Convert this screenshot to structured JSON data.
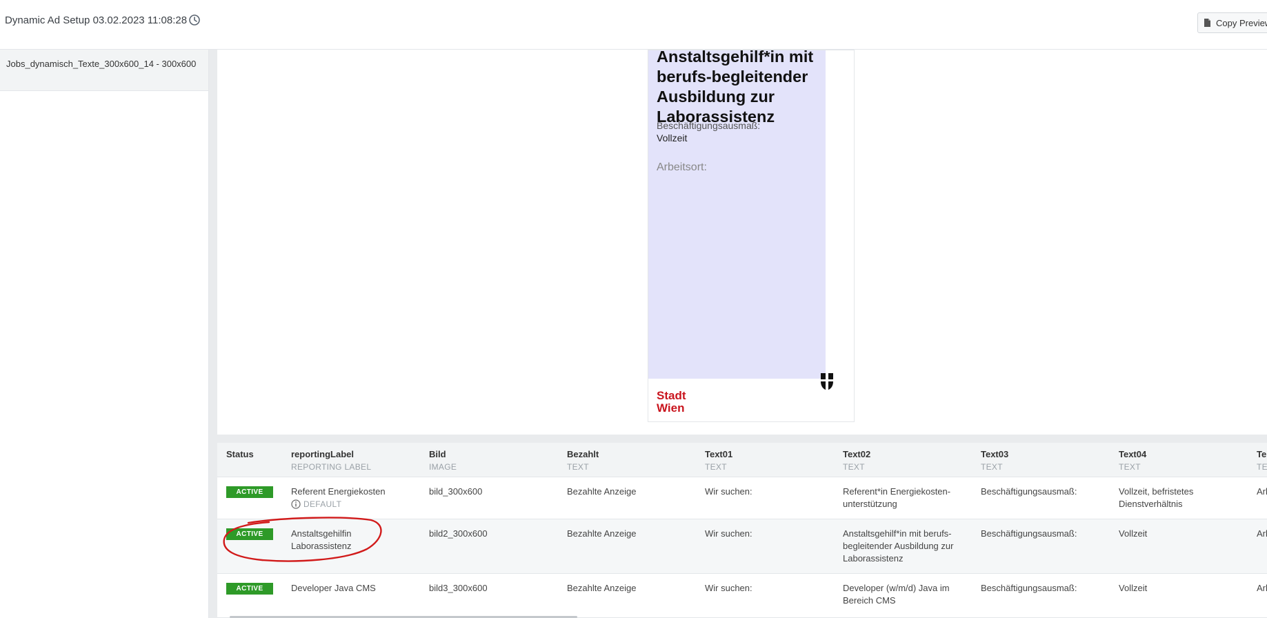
{
  "header": {
    "title": "Dynamic Ad Setup 03.02.2023 11:08:28",
    "copy_label": "Copy Preview"
  },
  "sidebar": {
    "items": [
      {
        "label": "Jobs_dynamisch_Texte_300x600_14 - 300x600"
      }
    ]
  },
  "ad_preview": {
    "headline": "Anstaltsgehilf*in mit berufs-begleitender Ausbildung zur Laborassistenz",
    "beschaeftigung_label": "Beschäftigungsausmaß:",
    "beschaeftigung_value": "Vollzeit",
    "arbeitsort_label": "Arbeitsort:",
    "logo_line1": "Stadt",
    "logo_line2": "Wien"
  },
  "table": {
    "columns": [
      {
        "name": "Status",
        "type": ""
      },
      {
        "name": "reportingLabel",
        "type": "REPORTING LABEL"
      },
      {
        "name": "Bild",
        "type": "IMAGE"
      },
      {
        "name": "Bezahlt",
        "type": "TEXT"
      },
      {
        "name": "Text01",
        "type": "TEXT"
      },
      {
        "name": "Text02",
        "type": "TEXT"
      },
      {
        "name": "Text03",
        "type": "TEXT"
      },
      {
        "name": "Text04",
        "type": "TEXT"
      },
      {
        "name": "Te",
        "type": "TE"
      }
    ],
    "default_label": "DEFAULT",
    "rows": [
      {
        "status": "ACTIVE",
        "reporting_label": "Referent Energiekosten",
        "bild": "bild_300x600",
        "bezahlt": "Bezahlte Anzeige",
        "text01": "Wir suchen:",
        "text02": "Referent*in Energiekosten-unterstützung",
        "text03": "Beschäftigungsausmaß:",
        "text04": "Vollzeit, befristetes Dienstverhältnis",
        "text05": "Arl"
      },
      {
        "status": "ACTIVE",
        "reporting_label": "Anstaltsgehilfin Laborassistenz",
        "bild": "bild2_300x600",
        "bezahlt": "Bezahlte Anzeige",
        "text01": "Wir suchen:",
        "text02": "Anstaltsgehilf*in mit berufs-begleitender Ausbildung zur Laborassistenz",
        "text03": "Beschäftigungsausmaß:",
        "text04": "Vollzeit",
        "text05": "Arl"
      },
      {
        "status": "ACTIVE",
        "reporting_label": "Developer Java CMS",
        "bild": "bild3_300x600",
        "bezahlt": "Bezahlte Anzeige",
        "text01": "Wir suchen:",
        "text02": "Developer (w/m/d) Java im Bereich CMS",
        "text03": "Beschäftigungsausmaß:",
        "text04": "Vollzeit",
        "text05": "Arl"
      }
    ]
  },
  "colors": {
    "active_badge": "#2e9a28",
    "ad_background": "#e3e3fa",
    "logo_red": "#c9151e",
    "highlight_red": "#d11a1a"
  }
}
